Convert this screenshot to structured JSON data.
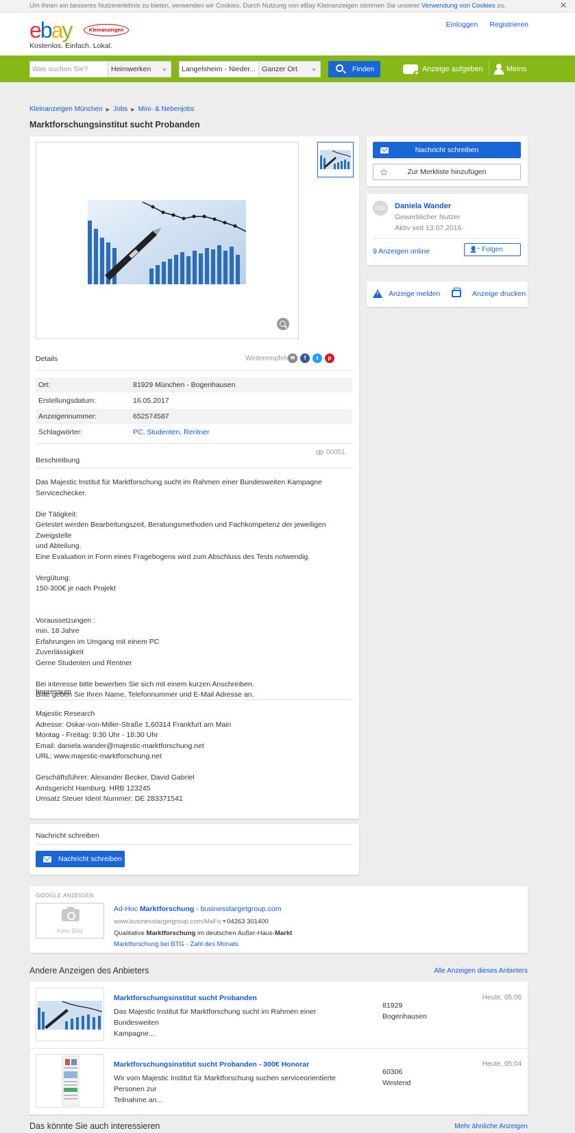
{
  "cookie": {
    "text": "Um Ihnen ein besseres Nutzererlebnis zu bieten, verwenden wir Cookies. Durch Nutzung von eBay Kleinanzeigen stimmen Sie unserer",
    "link": "Verwendung von Cookies",
    "suffix": "zu.",
    "close": "×"
  },
  "header": {
    "logo_letters": [
      "e",
      "b",
      "a",
      "y"
    ],
    "badge": "Kleinanzeigen",
    "slogan": "Kostenlos. Einfach. Lokal.",
    "login": "Einloggen",
    "register": "Registrieren"
  },
  "search": {
    "query_placeholder": "Was suchen Sie?",
    "category": "Heimwerken",
    "location": "Langelsheim - Nieder...",
    "radius": "Ganzer Ort",
    "find": "Finden",
    "post_ad": "Anzeige aufgeben",
    "account": "Meins"
  },
  "breadcrumb": [
    "Kleinanzeigen München",
    "Jobs",
    "Mini- & Nebenjobs"
  ],
  "ad": {
    "title": "Marktforschungsinstitut sucht Probanden",
    "details_label": "Details",
    "share_label": "Weiterempfehlen:",
    "attributes": [
      {
        "key": "Ort:",
        "value": "81929 München - Bogenhausen"
      },
      {
        "key": "Erstellungsdatum:",
        "value": "16.05.2017"
      },
      {
        "key": "Anzeigennummer:",
        "value": "652574587"
      },
      {
        "key": "Schlagwörter:",
        "value": "PC, Studenten, Rentner"
      }
    ],
    "views": "00051",
    "description_label": "Beschreibung",
    "description": [
      "Das Majestic Institut für Marktforschung sucht im Rahmen einer Bundesweiten Kampagne Servicechecker.",
      "",
      "Die Tätigkeit:",
      "Getestet werden Bearbeitungszeit, Beratungsmethoden und Fachkompetenz der jeweiligen Zweigstelle",
      "und Abteilung.",
      "Eine Evaluation in Form eines Fragebogens wird zum Abschluss des Tests notwendig.",
      "",
      "Vergütung:",
      "150-300€ je nach Projekt",
      "",
      "",
      "Voraussetzungen :",
      "min. 18 Jahre",
      "Erfahrungen im Umgang mit einem PC",
      "Zuverlässigkeit",
      "Gerne Studenten und Rentner",
      "",
      "Bei interesse bitte bewerben Sie sich mit einem kurzen Anschreiben.",
      "Bitte geben Sie Ihren Name, Telefonnummer und E-Mail Adresse an."
    ],
    "impressum_label": "Impressum",
    "impressum": [
      "Majestic Research",
      "Adresse: Oskar-von-Miller-Straße 1,60314 Frankfurt am Main",
      "Montag - Freitag: 9:30 Uhr - 18:30 Uhr",
      "Email: daniela.wander@majestic-marktforschung.net",
      "URL: www.majestic-marktforschung.net",
      "",
      "Geschäftsführer: Alexander Becker, David Gabriel",
      "Amtsgericht Hamburg: HRB 123245",
      "Umsatz Steuer Ident Nummer: DE 283371541"
    ]
  },
  "message_card": {
    "heading": "Nachricht schreiben",
    "button": "Nachricht schreiben"
  },
  "sidebar": {
    "contact": "Nachricht schreiben",
    "watchlist": "Zur Merkliste hinzufügen",
    "seller_initials": "DW",
    "seller_name": "Daniela Wander",
    "seller_type": "Gewerblicher Nutzer",
    "seller_since": "Aktiv seit 13.07.2016",
    "ads_online": "9 Anzeigen online",
    "follow": "Folgen",
    "report": "Anzeige melden",
    "print": "Anzeige drucken"
  },
  "google_ads": {
    "title": "GOOGLE ANZEIGEN",
    "no_image": "Kein Bild",
    "headline_prefix": "Ad-Hoc ",
    "headline_bold": "Marktforschung",
    "headline_suffix": " - businesstargetgroup.com",
    "url": "www.businesstargetgroup.com/MaFo ▾",
    "phone": "04263 301400",
    "desc_prefix": "Qualitative ",
    "desc_bold1": "Marktforschung",
    "desc_mid": " im deutschen Außer-Haus-",
    "desc_bold2": "Markt",
    "sitelink": "Marktforschung bei BTG - Zahl des Monats"
  },
  "other_ads": {
    "heading": "Andere Anzeigen des Anbieters",
    "all_link": "Alle Anzeigen dieses Anbieters",
    "items": [
      {
        "title": "Marktforschungsinstitut sucht Probanden",
        "desc1": "Das Majestic Institut für Marktforschung sucht im Rahmen einer Bundesweiten",
        "desc2": "Kampagne...",
        "plz": "81929",
        "district": "Bogenhausen",
        "date": "Heute, 05:06"
      },
      {
        "title": "Marktforschungsinstitut sucht Probanden - 300€ Honorar",
        "desc1": "Wir vom Majestic Institut für Marktforschung suchen serviceorientierte Personen zur",
        "desc2": "Teilnahme an...",
        "plz": "60306",
        "district": "Westend",
        "date": "Heute, 05:04"
      }
    ]
  },
  "related": {
    "heading": "Das könnte Sie auch interessieren",
    "more_link": "Mehr ähnliche Anzeigen"
  },
  "colors": {
    "brand_green": "#86b817",
    "primary_blue": "#1a66d6",
    "facebook": "#3b5998",
    "twitter": "#1da1f2",
    "pinterest": "#cb2027",
    "mail": "#888888"
  },
  "icons": [
    "close-icon",
    "search-icon",
    "camera-plus-icon",
    "user-icon",
    "envelope-icon",
    "star-icon",
    "person-add-icon",
    "warning-icon",
    "printer-icon",
    "zoom-icon",
    "eye-icon",
    "camera-icon"
  ]
}
